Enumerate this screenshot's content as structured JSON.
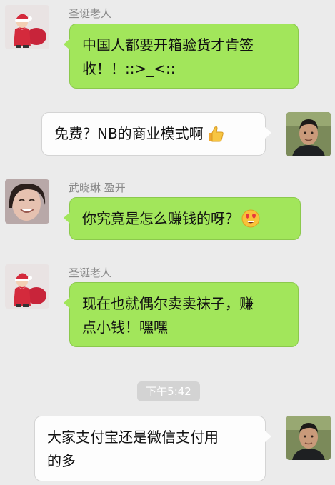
{
  "colors": {
    "background": "#ebebeb",
    "bubble_green": "#a2e65b",
    "bubble_white": "#fdfdfd",
    "timestamp_bg": "#d3d3d3"
  },
  "messages": [
    {
      "sender": "圣诞老人",
      "avatar": "santa-claus-avatar",
      "lines": [
        "中国人都要开箱验货才肯签",
        "收！！::>_<::"
      ]
    },
    {
      "sender": "",
      "avatar": "man-avatar",
      "lines": [
        "免费？NB的商业模式啊"
      ],
      "emoji": "thumbs-up-icon"
    },
    {
      "sender": "武晓琳 盈开",
      "avatar": "woman-avatar",
      "lines": [
        "你究竟是怎么赚钱的呀？"
      ],
      "emoji": "heart-eyes-icon"
    },
    {
      "sender": "圣诞老人",
      "avatar": "santa-claus-avatar",
      "lines": [
        "现在也就偶尔卖卖袜子，赚",
        "点小钱！嘿嘿"
      ]
    },
    {
      "sender": "",
      "avatar": "man-avatar",
      "lines": [
        "大家支付宝还是微信支付用",
        "的多"
      ]
    }
  ],
  "timestamp": "下午5:42"
}
